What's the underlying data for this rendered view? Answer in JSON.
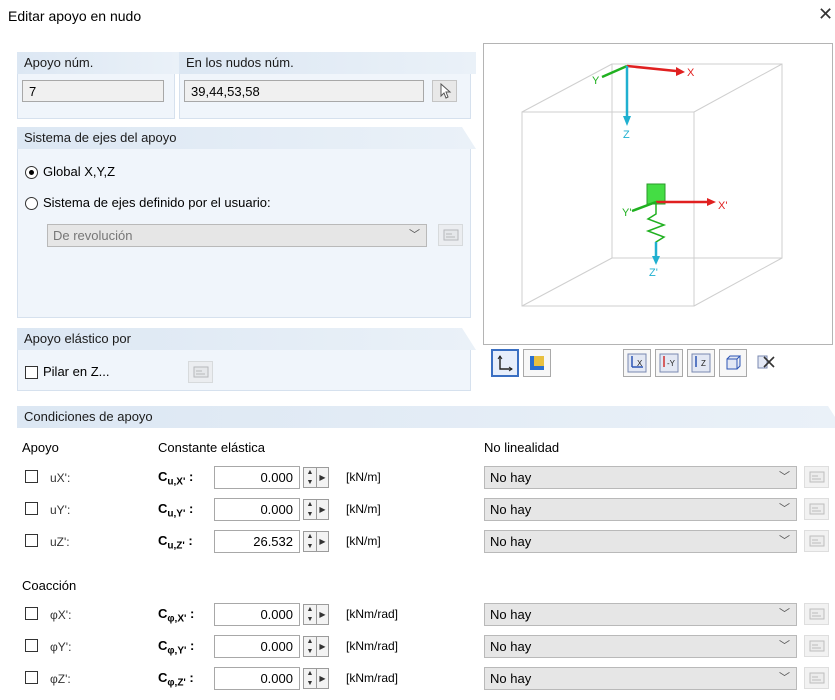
{
  "window": {
    "title": "Editar apoyo en nudo",
    "close_icon": "close-icon"
  },
  "support_no": {
    "label": "Apoyo núm.",
    "value": "7"
  },
  "nodes": {
    "label": "En los nudos núm.",
    "value": "39,44,53,58",
    "pick_icon": "pointer-icon"
  },
  "axis_system": {
    "header": "Sistema de ejes del apoyo",
    "global_label": "Global X,Y,Z",
    "user_label": "Sistema de ejes definido por el usuario:",
    "user_select": "De revolución",
    "selected": "global"
  },
  "elastic": {
    "header": "Apoyo elástico por",
    "column_label": "Pilar en Z..."
  },
  "preview": {
    "axes": {
      "x": "X",
      "y": "Y",
      "z": "Z",
      "xp": "X'",
      "yp": "Y'",
      "zp": "Z'"
    },
    "colors": {
      "x": "#e02020",
      "y": "#20b020",
      "z": "#20b0d0"
    }
  },
  "conditions": {
    "header": "Condiciones de apoyo",
    "col_support": "Apoyo",
    "col_spring": "Constante elástica",
    "col_nonlin": "No linealidad",
    "restraint_label": "Coacción",
    "rows": [
      {
        "check": "uX':",
        "coef": "C",
        "sub": "u,X'",
        "value": "0.000",
        "unit": "[kN/m]",
        "nonlin": "No hay"
      },
      {
        "check": "uY':",
        "coef": "C",
        "sub": "u,Y'",
        "value": "0.000",
        "unit": "[kN/m]",
        "nonlin": "No hay"
      },
      {
        "check": "uZ':",
        "coef": "C",
        "sub": "u,Z'",
        "value": "26.532",
        "unit": "[kN/m]",
        "nonlin": "No hay"
      },
      {
        "check": "φX':",
        "coef": "C",
        "sub": "φ,X'",
        "value": "0.000",
        "unit": "[kNm/rad]",
        "nonlin": "No hay"
      },
      {
        "check": "φY':",
        "coef": "C",
        "sub": "φ,Y'",
        "value": "0.000",
        "unit": "[kNm/rad]",
        "nonlin": "No hay"
      },
      {
        "check": "φZ':",
        "coef": "C",
        "sub": "φ,Z'",
        "value": "0.000",
        "unit": "[kNm/rad]",
        "nonlin": "No hay"
      }
    ]
  }
}
